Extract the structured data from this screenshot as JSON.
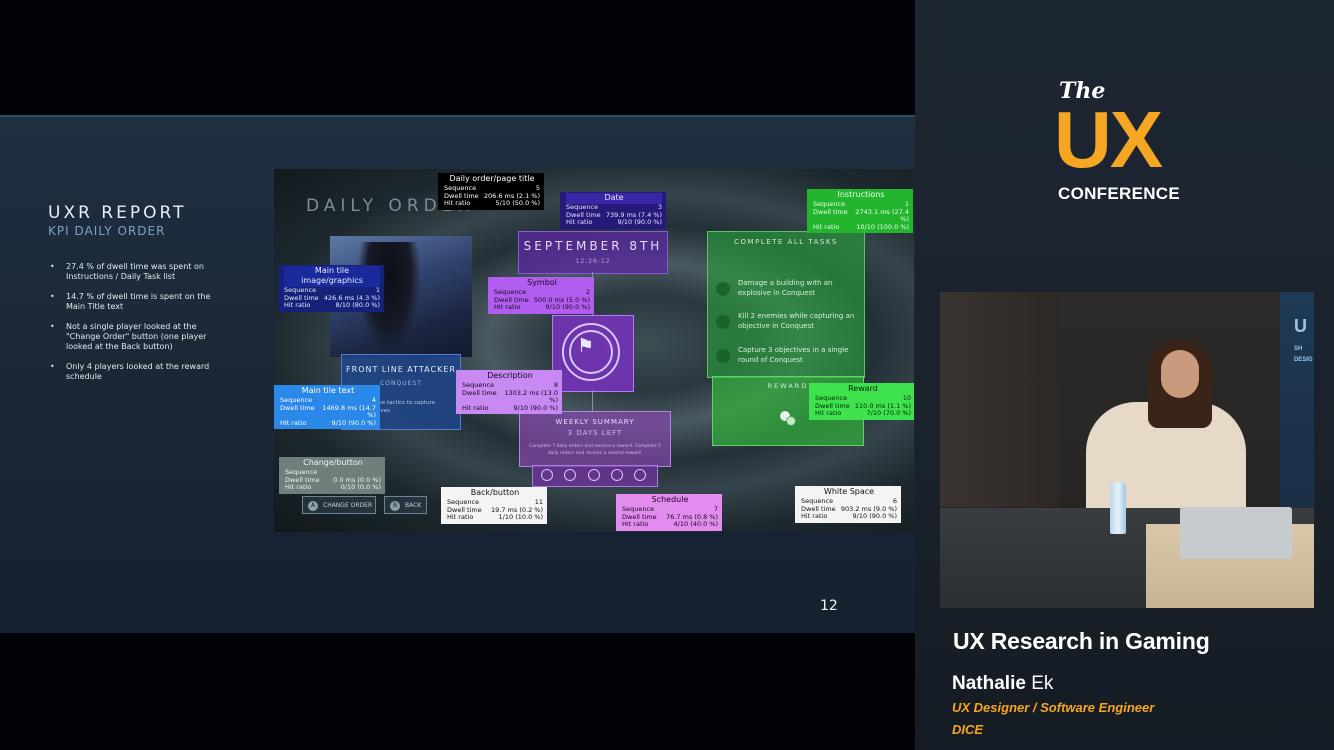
{
  "slide": {
    "title": "UXR REPORT",
    "subtitle": "KPI DAILY ORDER",
    "bullets": [
      "27.4 % of dwell time was spent on Instructions / Daily Task list",
      "14.7 % of dwell time is spent on the Main Title text",
      "Not a single player looked at the \"Change Order\" button (one player looked at the Back button)",
      "Only 4 players looked at the reward schedule"
    ],
    "page_number": "12"
  },
  "game": {
    "daily_order_title": "DAILY ORDER",
    "front_line_title": "FRONT LINE ATTACKER",
    "front_line_sub": "CONQUEST",
    "front_line_desc": "...ensive tactics to capture objectives",
    "date_text": "SEPTEMBER 8TH",
    "date_sub": "12:26:12",
    "weekly_title": "WEEKLY SUMMARY",
    "weekly_left": "3 DAYS LEFT",
    "weekly_desc": "Complete 7 daily orders and receive a reward. Complete 5 daily orders and receive a second reward.",
    "tasks_title": "COMPLETE ALL TASKS",
    "tasks": [
      "Damage a building with an explosive in Conquest",
      "Kill 2 enemies while capturing an objective in Conquest",
      "Capture 3 objectives in a single round of Conquest"
    ],
    "reward_title": "REWARD",
    "change_order_label": "CHANGE ORDER",
    "back_label": "BACK",
    "btn_icon_a": "A",
    "btn_icon_b": "B",
    "flag_icon": "⚑"
  },
  "annotations": [
    {
      "title": "Daily order/page title",
      "seq": "5",
      "dwell": "206.6 ms (2.1 %)",
      "hit": "5/10 (50.0 %)",
      "color": "#000000"
    },
    {
      "title": "Date",
      "seq": "3",
      "dwell": "739.9 ms (7.4 %)",
      "hit": "9/10 (90.0 %)",
      "color": "#251a7a"
    },
    {
      "title": "Instructions",
      "seq": "1",
      "dwell": "2743.1 ms (27.4 %)",
      "hit": "10/10 (100.0 %)",
      "color": "#24b52f"
    },
    {
      "title": "Main tile image/graphics",
      "seq": "1",
      "dwell": "426.6 ms (4.3 %)",
      "hit": "8/10 (80.0 %)",
      "color": "#16217a"
    },
    {
      "title": "Symbol",
      "seq": "2",
      "dwell": "500.0 ms (5.0 %)",
      "hit": "9/10 (90.0 %)",
      "color": "#b15ef0"
    },
    {
      "title": "Description",
      "seq": "8",
      "dwell": "1303.2 ms (13.0 %)",
      "hit": "9/10 (90.0 %)",
      "color": "#c889f3"
    },
    {
      "title": "Main tile text",
      "seq": "4",
      "dwell": "1469.8 ms (14.7 %)",
      "hit": "9/10 (90.0 %)",
      "color": "#2a88e8"
    },
    {
      "title": "Reward",
      "seq": "10",
      "dwell": "110.0 ms (1.1 %)",
      "hit": "7/10 (70.0 %)",
      "color": "#3de24c"
    },
    {
      "title": "Change/button",
      "seq": "",
      "dwell": "0.0 ms (0.0 %)",
      "hit": "0/10 (0.0 %)",
      "color": "#6f7f7c"
    },
    {
      "title": "Back/button",
      "seq": "11",
      "dwell": "19.7 ms (0.2 %)",
      "hit": "1/10 (10.0 %)",
      "color": "#f4f4f4"
    },
    {
      "title": "Schedule",
      "seq": "7",
      "dwell": "76.7 ms (0.8 %)",
      "hit": "4/10 (40.0 %)",
      "color": "#e38cf0"
    },
    {
      "title": "White Space",
      "seq": "6",
      "dwell": "903.2 ms (9.0 %)",
      "hit": "9/10 (90.0 %)",
      "color": "#f4f4f4"
    }
  ],
  "ann_labels": {
    "sequence": "Sequence",
    "dwell": "Dwell time",
    "hit": "Hit ratio"
  },
  "sidebar": {
    "logo_the": "The",
    "logo_ux": "UX",
    "logo_conference": "CONFERENCE",
    "banner_text": "U",
    "banner_sub": "SH DESIG",
    "talk_title": "UX Research in Gaming",
    "speaker_first": "Nathalie",
    "speaker_last": "Ek",
    "role": "UX Designer / Software Engineer",
    "org": "DICE",
    "accent_color": "#f5a623"
  }
}
